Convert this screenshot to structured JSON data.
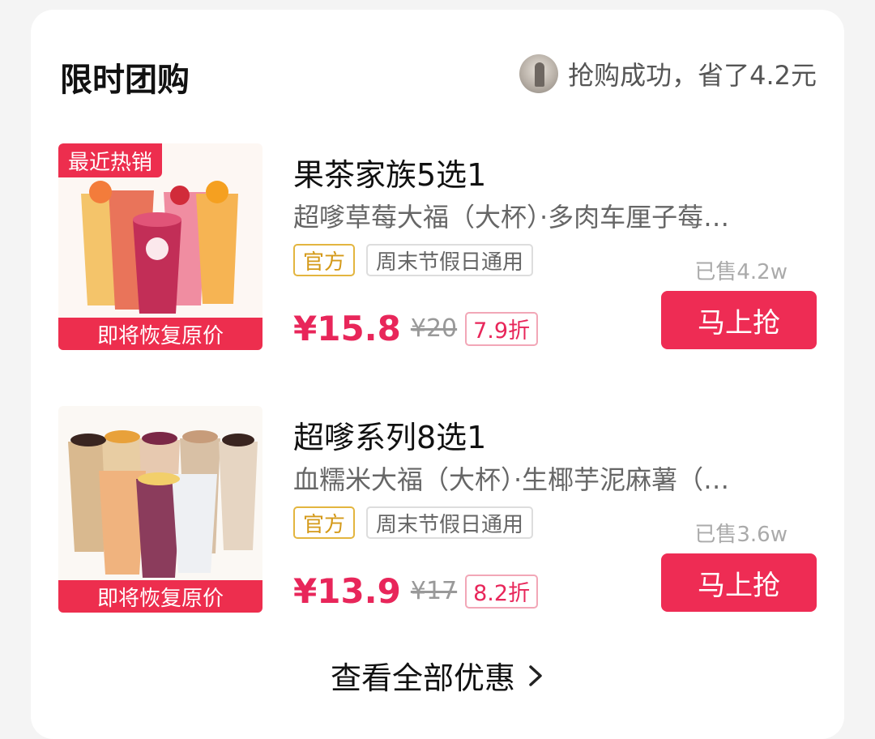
{
  "header": {
    "title": "限时团购",
    "notice": "抢购成功，省了4.2元"
  },
  "deals": [
    {
      "badge": "最近热销",
      "banner": "即将恢复原价",
      "title": "果茶家族5选1",
      "subtitle": "超嗲草莓大福（大杯）·多肉车厘子莓…",
      "tag_official": "官方",
      "tag_weekend": "周末节假日通用",
      "sold": "已售4.2w",
      "price": "¥15.8",
      "original_price": "¥20",
      "discount": "7.9折",
      "button": "马上抢"
    },
    {
      "banner": "即将恢复原价",
      "title": "超嗲系列8选1",
      "subtitle": "血糯米大福（大杯）·生椰芋泥麻薯（…",
      "tag_official": "官方",
      "tag_weekend": "周末节假日通用",
      "sold": "已售3.6w",
      "price": "¥13.9",
      "original_price": "¥17",
      "discount": "8.2折",
      "button": "马上抢"
    }
  ],
  "footer": {
    "see_all": "查看全部优惠"
  },
  "colors": {
    "accent": "#ee2c54",
    "official": "#d49a1a"
  }
}
